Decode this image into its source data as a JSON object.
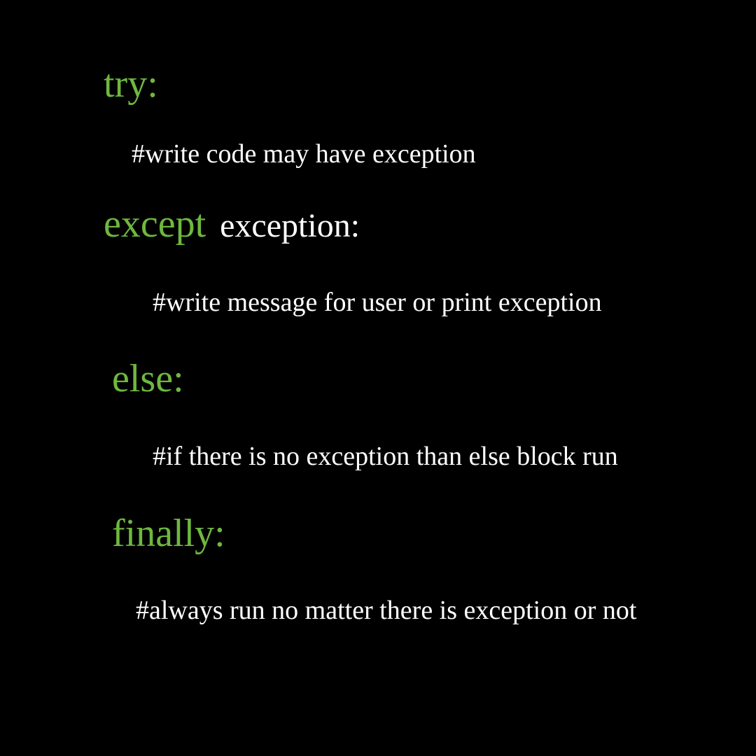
{
  "blocks": {
    "try": {
      "keyword": "try:",
      "comment": "#write code may have exception"
    },
    "except": {
      "keyword": "except",
      "exception_text": " exception:",
      "comment": "#write message for user or print exception"
    },
    "else": {
      "keyword": "else:",
      "comment": "#if there is no exception than else block run"
    },
    "finally": {
      "keyword": "finally:",
      "comment": "#always run no matter there is exception or not"
    }
  }
}
